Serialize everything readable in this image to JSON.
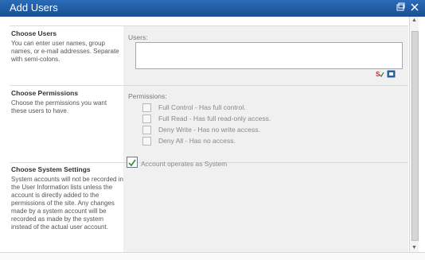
{
  "window": {
    "title": "Add Users",
    "restore_icon": "restore-icon",
    "close_icon": "close-icon"
  },
  "sections": {
    "users": {
      "title": "Choose Users",
      "desc": "You can enter user names, group names, or e-mail addresses. Separate with semi-colons.",
      "field_label": "Users:",
      "field_value": ""
    },
    "permissions": {
      "title": "Choose Permissions",
      "desc": "Choose the permissions you want these users to have.",
      "field_label": "Permissions:",
      "options": [
        "Full Control - Has full control.",
        "Full Read - Has full read-only access.",
        "Deny Write - Has no write access.",
        "Deny All - Has no access."
      ]
    },
    "system": {
      "title": "Choose System Settings",
      "desc": "System accounts will not be recorded in the User Information lists unless the account is directly added to the permissions of the site. Any changes made by a system account will be recorded as made by the system instead of the actual user account.",
      "checkbox_label": "Account operates as System",
      "checked": true
    }
  },
  "icons": {
    "check_names": "check-names-icon",
    "browse": "address-book-icon"
  },
  "colors": {
    "titlebar": "#1f5aa6",
    "right_panel": "#f0f0f0",
    "text_muted": "#888888"
  }
}
